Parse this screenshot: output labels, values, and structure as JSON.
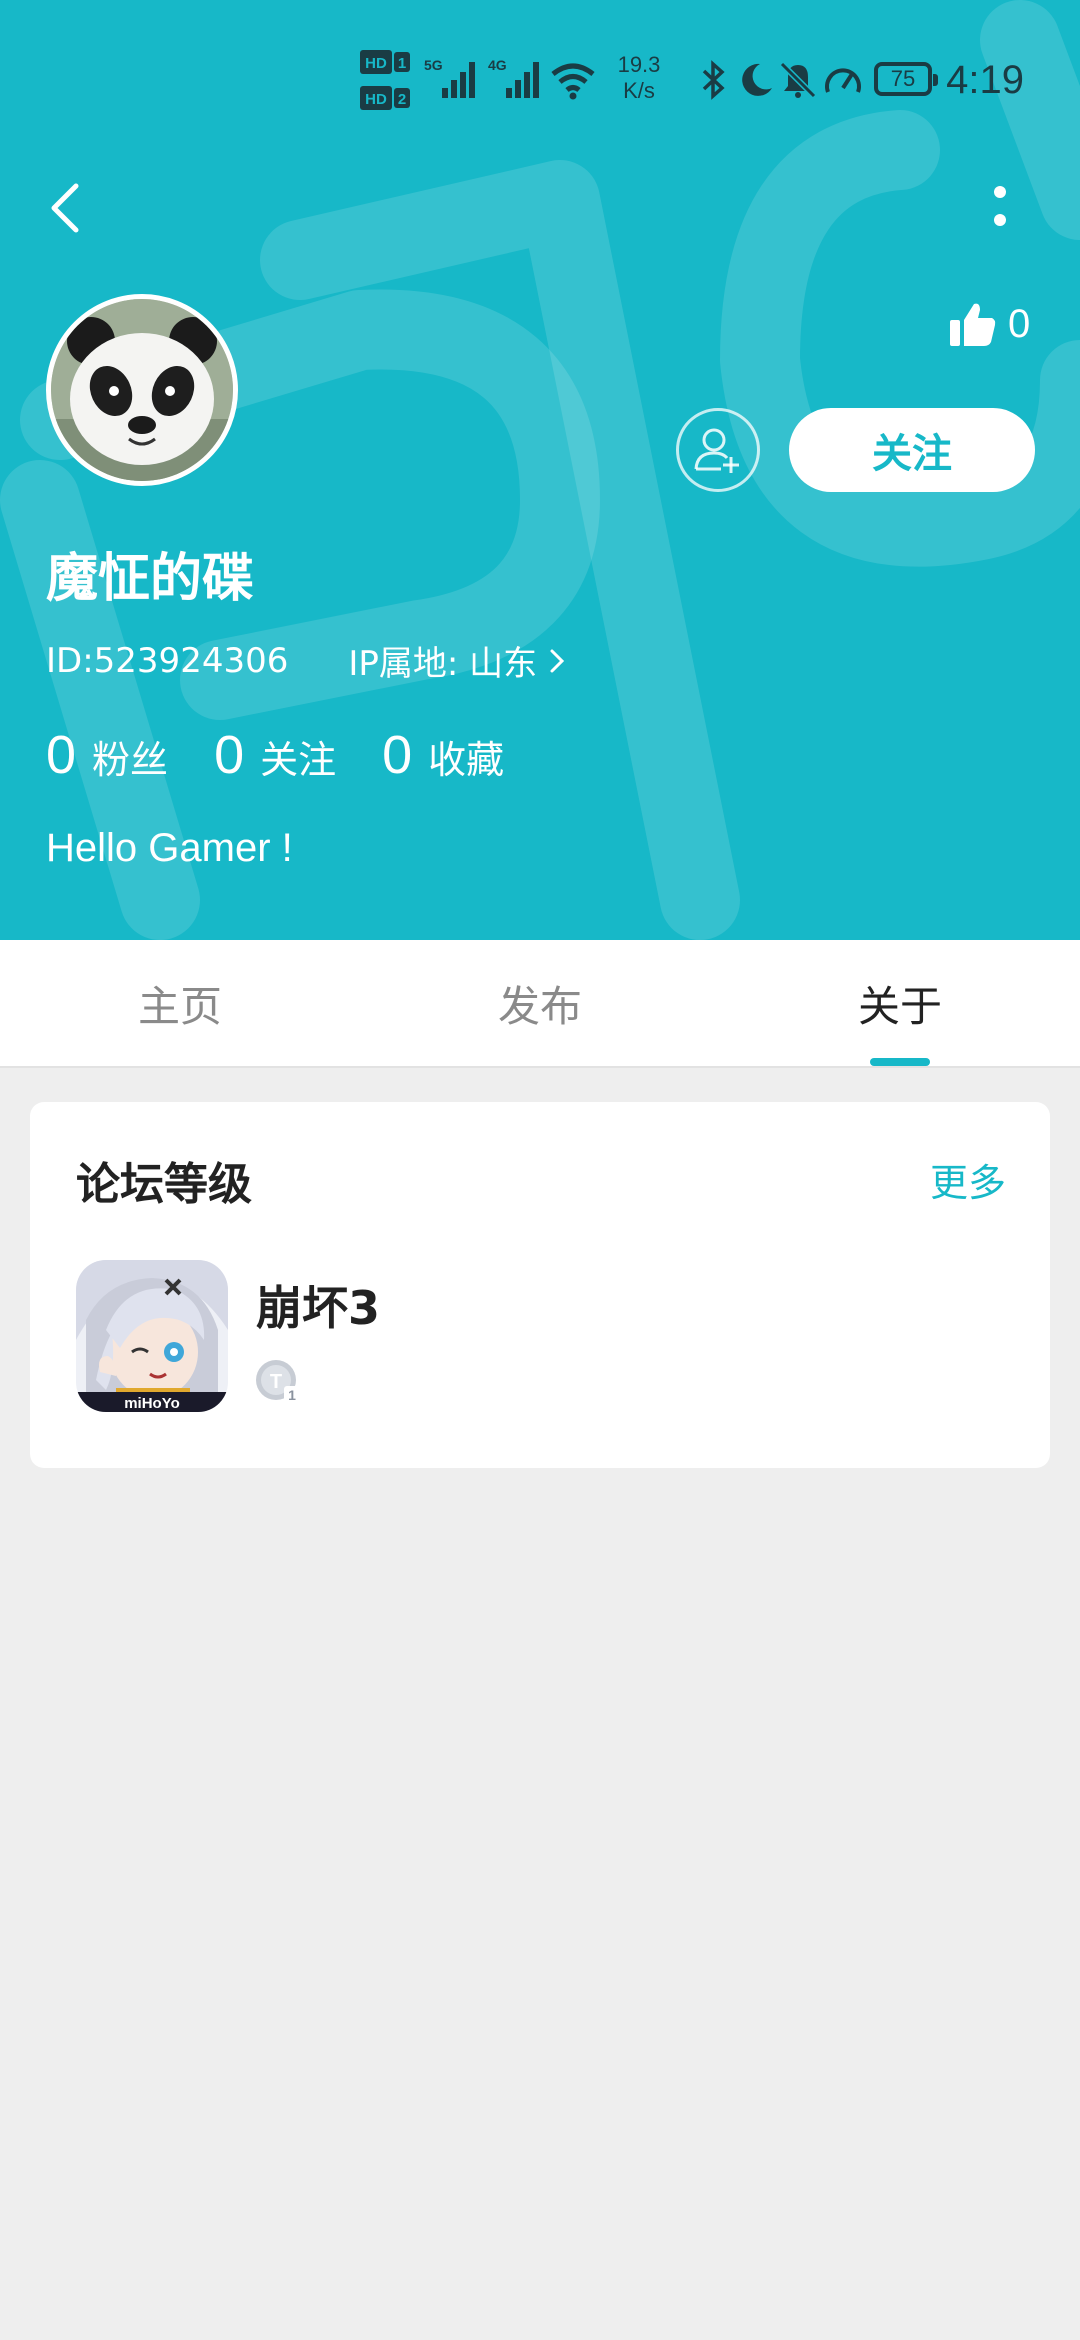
{
  "status_bar": {
    "hd1": "HD 1",
    "hd2": "HD 2",
    "net1": "5G",
    "net2": "4G",
    "speed_value": "19.3",
    "speed_unit": "K/s",
    "battery": "75",
    "time": "4:19"
  },
  "profile": {
    "likes": "0",
    "follow_label": "关注",
    "username": "魔怔的碟",
    "id": "ID:523924306",
    "ip_label": "IP属地: 山东",
    "stats": [
      {
        "value": "0",
        "label": "粉丝"
      },
      {
        "value": "0",
        "label": "关注"
      },
      {
        "value": "0",
        "label": "收藏"
      }
    ],
    "bio": "Hello Gamer !"
  },
  "tabs": [
    {
      "label": "主页",
      "active": false
    },
    {
      "label": "发布",
      "active": false
    },
    {
      "label": "关于",
      "active": true
    }
  ],
  "forum_level": {
    "title": "论坛等级",
    "more_label": "更多",
    "games": [
      {
        "name": "崩坏3",
        "icon_text": "miHoYo",
        "level_badge": "T1"
      }
    ]
  },
  "colors": {
    "accent": "#17b8c8",
    "background": "#eeeeee",
    "card": "#ffffff"
  }
}
